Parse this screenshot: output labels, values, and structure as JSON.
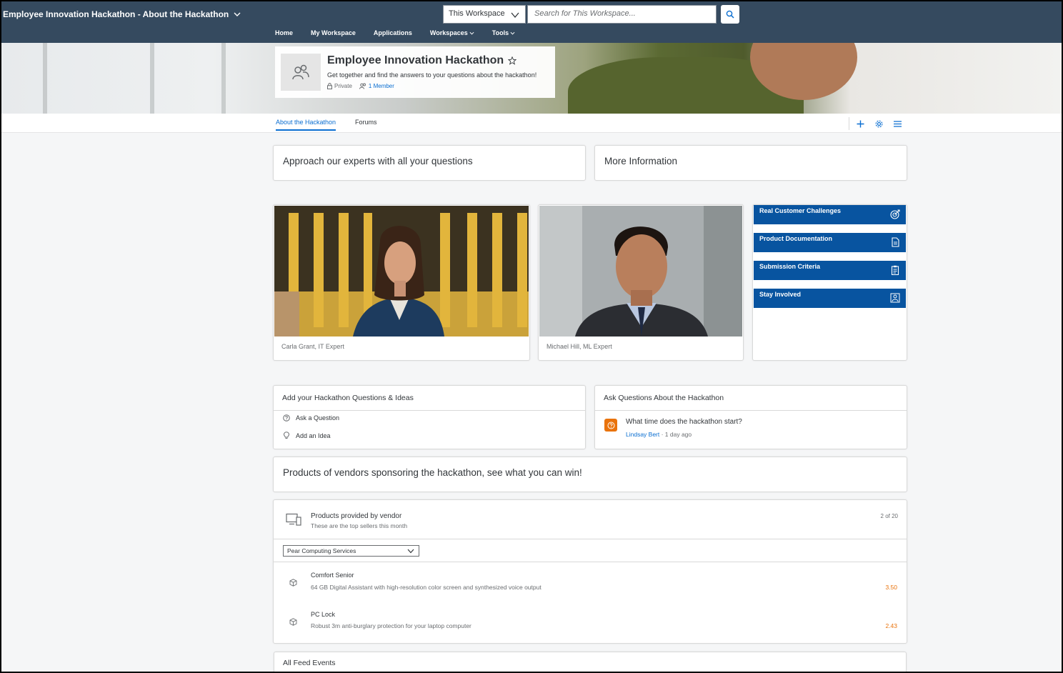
{
  "shell": {
    "title": "Employee Innovation Hackathon - About the Hackathon",
    "scope": "This Workspace",
    "search_placeholder": "Search for This Workspace...",
    "nav": [
      {
        "label": "Home"
      },
      {
        "label": "My Workspace"
      },
      {
        "label": "Applications"
      },
      {
        "label": "Workspaces",
        "dropdown": true
      },
      {
        "label": "Tools",
        "dropdown": true
      }
    ],
    "colors": {
      "shell_bg": "#354a5f",
      "accent": "#0a6ed1",
      "tile": "#0854a0",
      "price": "#e9730c"
    }
  },
  "workspace": {
    "name": "Employee Innovation Hackathon",
    "description": "Get together and find the answers to your questions about the hackathon!",
    "privacy": "Private",
    "members": "1 Member"
  },
  "tabs": [
    {
      "label": "About the Hackathon",
      "active": true
    },
    {
      "label": "Forums",
      "active": false
    }
  ],
  "headers": {
    "experts": "Approach our experts with all your questions",
    "more_info": "More Information"
  },
  "experts": [
    {
      "caption": "Carla Grant, IT Expert"
    },
    {
      "caption": "Michael Hill, ML Expert"
    }
  ],
  "info_links": [
    {
      "label": "Real Customer Challenges",
      "icon": "target-icon"
    },
    {
      "label": "Product Documentation",
      "icon": "document-icon"
    },
    {
      "label": "Submission Criteria",
      "icon": "clipboard-icon"
    },
    {
      "label": "Stay Involved",
      "icon": "group-icon"
    }
  ],
  "questions_ideas": {
    "title": "Add your Hackathon Questions & Ideas",
    "ask": "Ask a Question",
    "idea": "Add an Idea"
  },
  "ask_questions": {
    "title": "Ask Questions About the Hackathon",
    "question": "What time does the hackathon start?",
    "author": "Lindsay Bert",
    "time": " · 1 day ago"
  },
  "sponsors_title": "Products of vendors sponsoring the hackathon, see what you can win!",
  "products": {
    "title": "Products provided by vendor",
    "subtitle": "These are the top sellers this month",
    "count": "2 of 20",
    "vendor": "Pear Computing Services",
    "items": [
      {
        "name": "Comfort Senior",
        "desc": "64 GB Digital Assistant with high-resolution color screen and synthesized voice output",
        "price": "3.50"
      },
      {
        "name": "PC Lock",
        "desc": "Robust 3m anti-burglary protection for your laptop computer",
        "price": "2.43"
      }
    ]
  },
  "feed_title": "All Feed Events"
}
